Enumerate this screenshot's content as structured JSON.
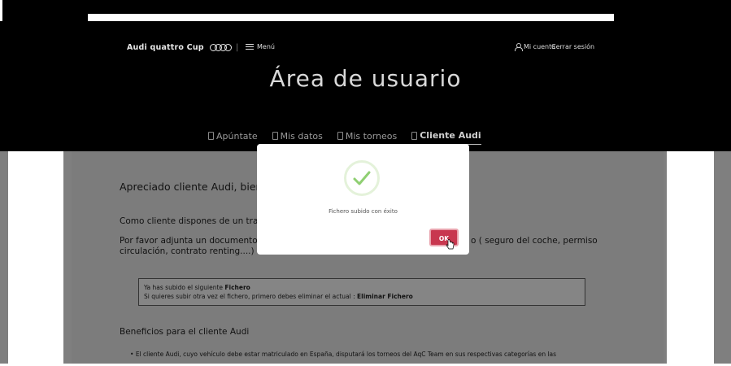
{
  "header": {
    "brand": "Audi quattro Cup",
    "menu_label": "Menú",
    "account_label": "Mi cuenta",
    "logout_label": "Cerrar sesión",
    "page_title": "Área de usuario"
  },
  "tabs": [
    {
      "label": "Apúntate",
      "active": false
    },
    {
      "label": "Mis datos",
      "active": false
    },
    {
      "label": "Mis torneos",
      "active": false
    },
    {
      "label": "Cliente Audi",
      "active": true
    }
  ],
  "content": {
    "greeting": "Apreciado cliente Audi, bien",
    "para1": "Como cliente dispones de un trat",
    "para2_line1": "Por favor adjunta un documento",
    "para2_line2": "circulación, contrato renting....)",
    "para2_tail": "o ( seguro del coche, permiso",
    "notice_line1_prefix": "Ya has subido el siguiente ",
    "notice_line1_bold": "Fichero",
    "notice_line2_prefix": "Si quieres subir otra vez el fichero, primero debes eliminar el actual : ",
    "notice_line2_link": "Eliminar Fichero",
    "benefits_title": "Beneficios para el cliente Audi",
    "benefit_1": "El cliente Audi, cuyo vehículo debe estar matriculado en España, disputará los torneos del AqC Team en sus respectivas categorías en las"
  },
  "modal": {
    "message": "Fichero subido con éxito",
    "ok_label": "OK",
    "icon": "check-icon",
    "accent": "#c8374f",
    "check_color": "#8fcf72"
  }
}
